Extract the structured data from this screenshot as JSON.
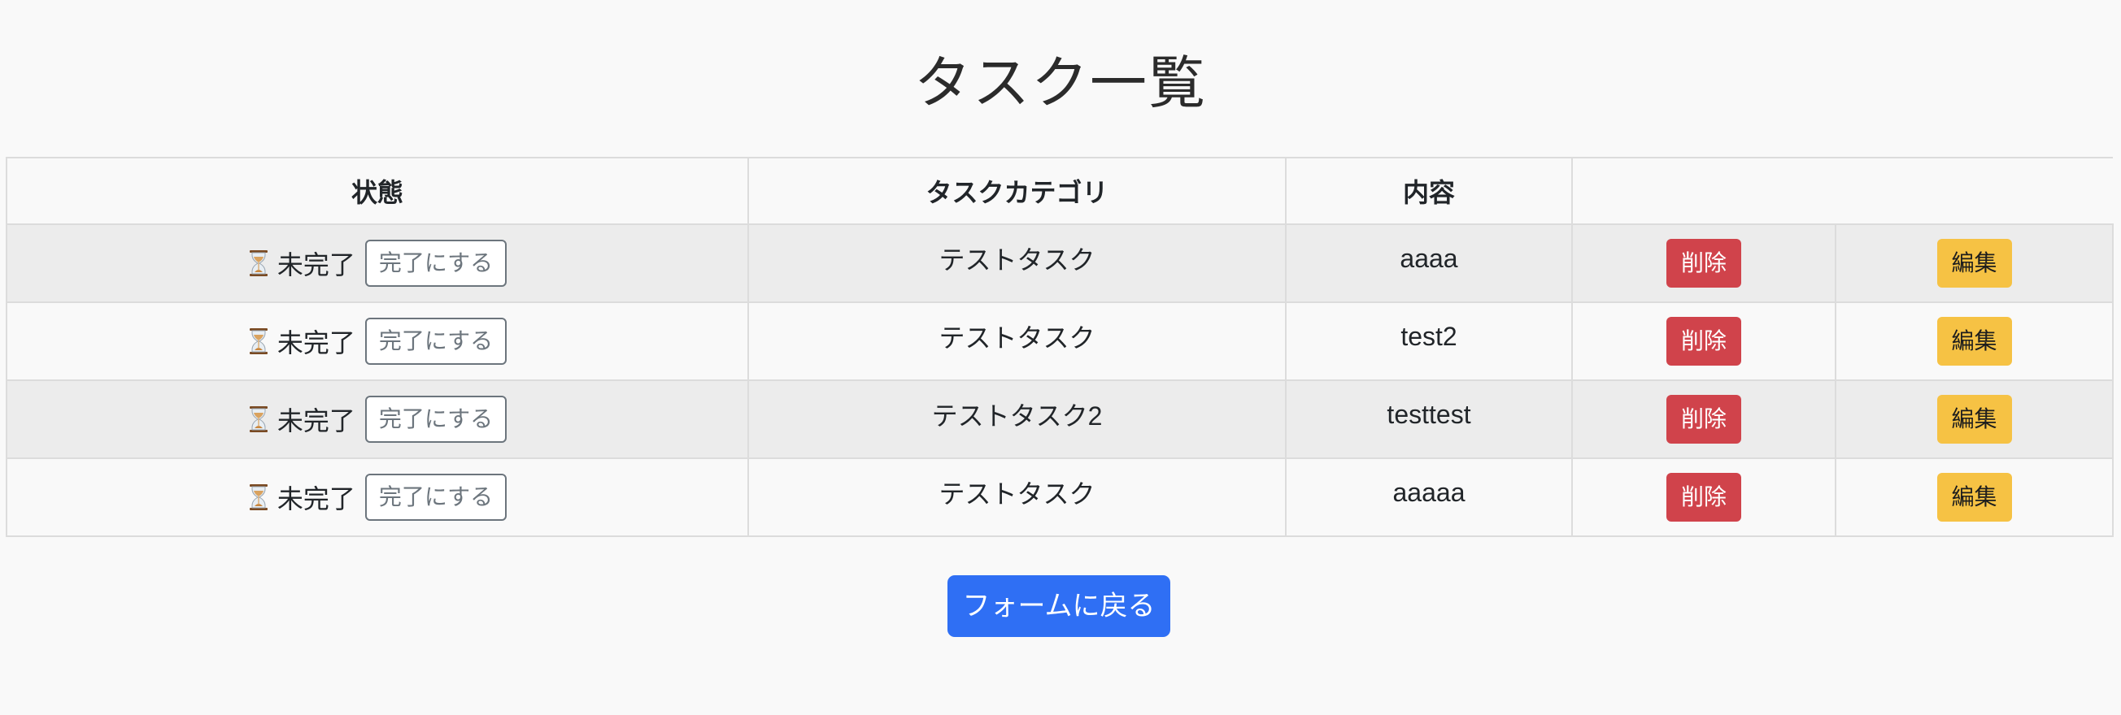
{
  "page": {
    "title": "タスク一覧"
  },
  "table": {
    "headers": {
      "status": "状態",
      "category": "タスクカテゴリ",
      "content": "内容"
    },
    "rows": [
      {
        "status": "未完了",
        "complete_label": "完了にする",
        "category": "テストタスク",
        "content": "aaaa",
        "delete_label": "削除",
        "edit_label": "編集"
      },
      {
        "status": "未完了",
        "complete_label": "完了にする",
        "category": "テストタスク",
        "content": "test2",
        "delete_label": "削除",
        "edit_label": "編集"
      },
      {
        "status": "未完了",
        "complete_label": "完了にする",
        "category": "テストタスク2",
        "content": "testtest",
        "delete_label": "削除",
        "edit_label": "編集"
      },
      {
        "status": "未完了",
        "complete_label": "完了にする",
        "category": "テストタスク",
        "content": "aaaaa",
        "delete_label": "削除",
        "edit_label": "編集"
      }
    ]
  },
  "footer": {
    "back_label": "フォームに戻る"
  },
  "icons": {
    "status_icon": "hourglass-icon"
  },
  "colors": {
    "delete": "#d0434b",
    "edit": "#f6c244",
    "primary": "#2f6ff4",
    "stripe": "#ececec",
    "background": "#f9f9f9"
  }
}
